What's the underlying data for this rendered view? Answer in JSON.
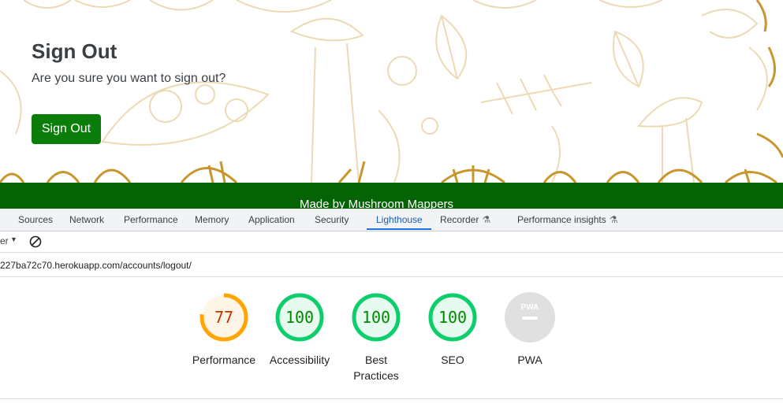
{
  "page": {
    "title": "Sign Out",
    "subtitle": "Are you sure you want to sign out?",
    "signout_button": "Sign Out",
    "footer_text": "Made by Mushroom Mappers"
  },
  "devtools": {
    "tabs": [
      {
        "label": "Sources"
      },
      {
        "label": "Network"
      },
      {
        "label": "Performance"
      },
      {
        "label": "Memory"
      },
      {
        "label": "Application"
      },
      {
        "label": "Security"
      },
      {
        "label": "Lighthouse",
        "active": true
      },
      {
        "label": "Recorder",
        "icon": "flask-icon"
      },
      {
        "label": "Performance insights",
        "icon": "flask-icon"
      }
    ],
    "toolbar": {
      "filter_label": "er"
    },
    "url": "227ba72c70.herokuapp.com/accounts/logout/",
    "scores": [
      {
        "label": "Performance",
        "value": "77",
        "score": 77,
        "status": "average"
      },
      {
        "label": "Accessibility",
        "value": "100",
        "score": 100,
        "status": "pass"
      },
      {
        "label": "Best Practices",
        "value": "100",
        "score": 100,
        "status": "pass"
      },
      {
        "label": "SEO",
        "value": "100",
        "score": 100,
        "status": "pass"
      },
      {
        "label": "PWA",
        "value": "PWA",
        "score": null,
        "status": "na"
      }
    ]
  },
  "colors": {
    "brand_green": "#0a7d0a",
    "footer_green": "#046304",
    "illustration_gold": "#c9962e",
    "score_pass": "#0cce6b",
    "score_pass_text": "#008800",
    "score_average": "#ffa400",
    "score_average_text": "#c33300",
    "score_na": "#e0e0e0"
  }
}
